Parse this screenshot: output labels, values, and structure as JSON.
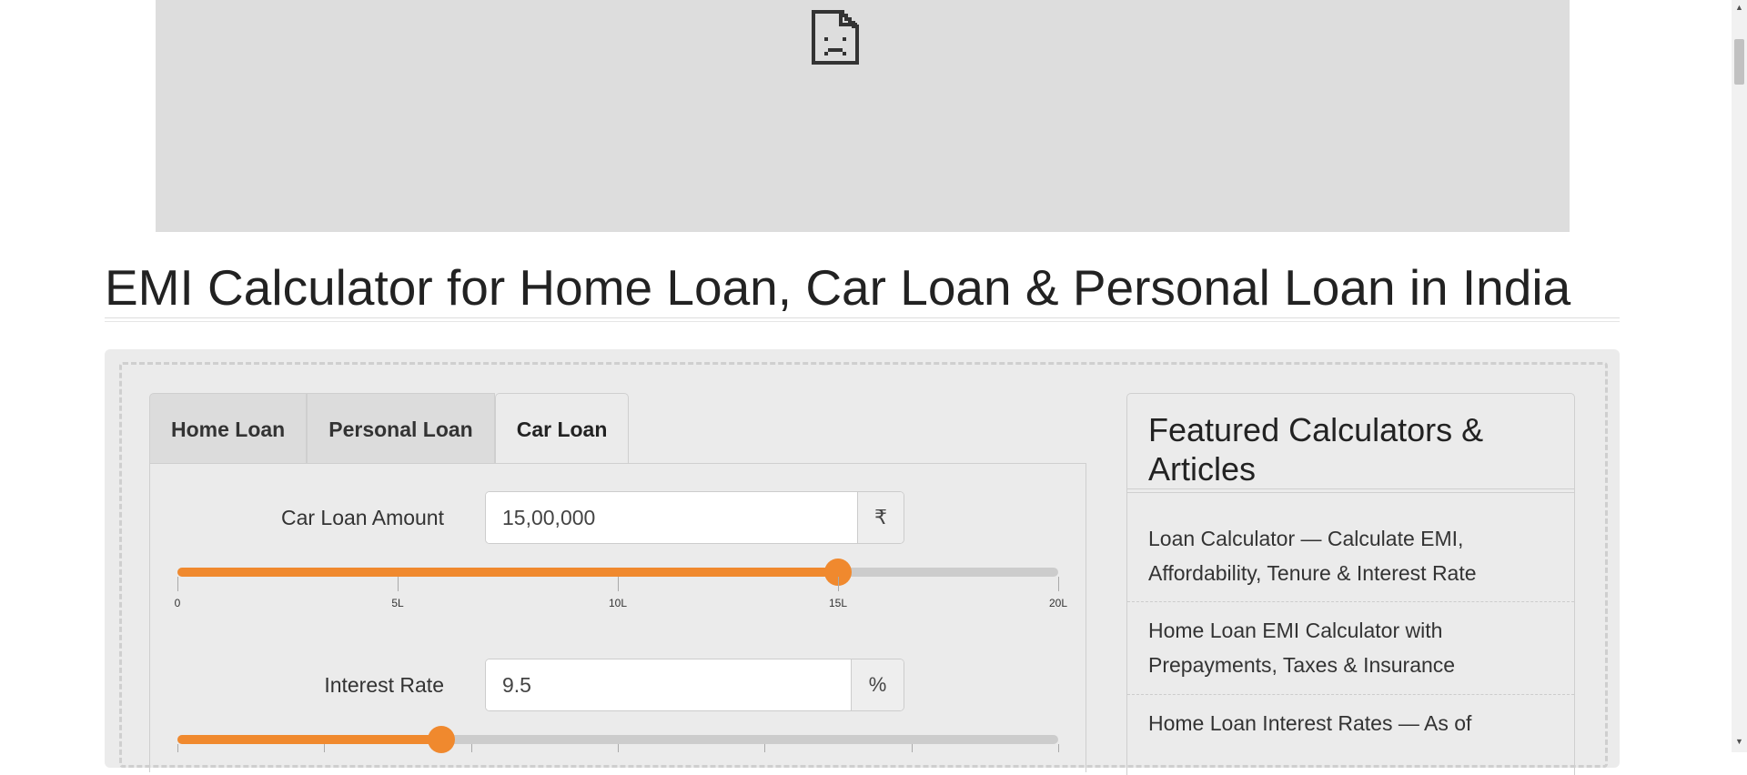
{
  "ad": {
    "icon": "broken-document-icon"
  },
  "page": {
    "title": "EMI Calculator for Home Loan, Car Loan & Personal Loan in India"
  },
  "tabs": [
    {
      "label": "Home Loan",
      "active": false
    },
    {
      "label": "Personal Loan",
      "active": false
    },
    {
      "label": "Car Loan",
      "active": true
    }
  ],
  "loan_amount": {
    "label": "Car Loan Amount",
    "value": "15,00,000",
    "unit": "₹",
    "slider_fraction": 0.75,
    "ticks": [
      "0",
      "5L",
      "10L",
      "15L",
      "20L"
    ]
  },
  "interest_rate": {
    "label": "Interest Rate",
    "value": "9.5",
    "unit": "%",
    "slider_fraction": 0.3
  },
  "featured": {
    "heading": "Featured Calculators & Articles",
    "items": [
      "Loan Calculator — Calculate EMI, Affordability, Tenure & Interest Rate",
      "Home Loan EMI Calculator with Prepayments, Taxes & Insurance",
      "Home Loan Interest Rates — As of"
    ]
  },
  "colors": {
    "accent": "#f0892e",
    "panel_bg": "#ebebeb"
  }
}
